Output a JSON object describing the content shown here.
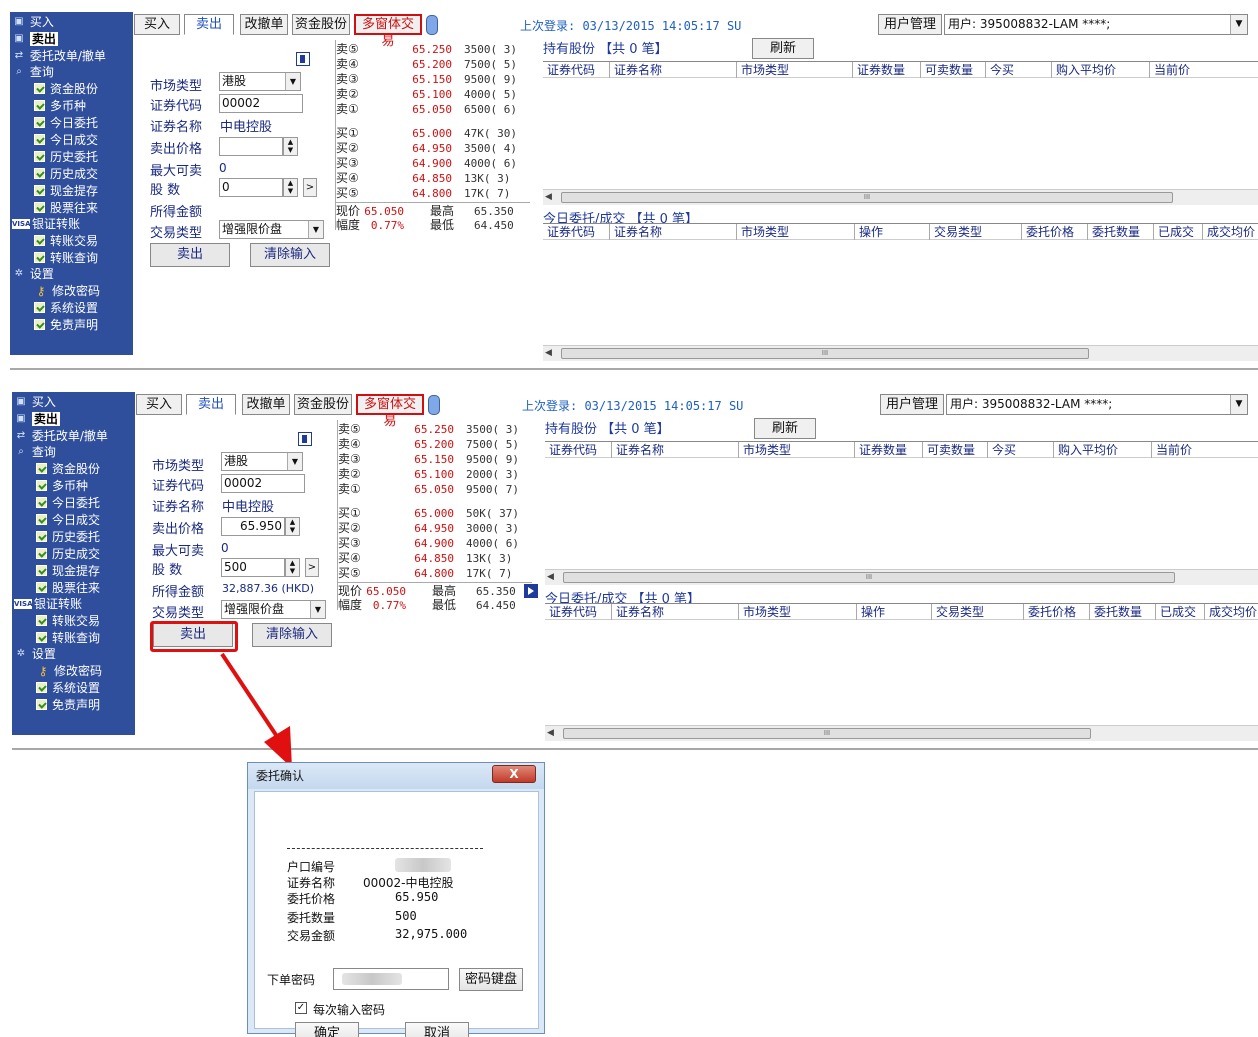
{
  "sidebar": {
    "buy": "买入",
    "sell": "卖出",
    "modify_cancel": "委托改单/撤单",
    "query": "查询",
    "query_items": [
      "资金股份",
      "多币种",
      "今日委托",
      "今日成交",
      "历史委托",
      "历史成交",
      "现金提存",
      "股票往来"
    ],
    "transfer": "银证转账",
    "transfer_items": [
      "转账交易",
      "转账查询"
    ],
    "settings": "设置",
    "settings_items": [
      "修改密码",
      "系统设置",
      "免责声明"
    ]
  },
  "tabs": [
    "买入",
    "卖出",
    "改撤单",
    "资金股份",
    "多窗体交易"
  ],
  "last_login": "上次登录: 03/13/2015 14:05:17 SU",
  "user_manage": "用户管理",
  "user_combo": "用户: 395008832-LAM ****;",
  "form": {
    "market_type_label": "市场类型",
    "market_type": "港股",
    "code_label": "证券代码",
    "code": "00002",
    "name_label": "证券名称",
    "name": "中电控股",
    "price_label": "卖出价格",
    "max_sell_label": "最大可卖",
    "max_sell": "0",
    "qty_label": "股    数",
    "amount_label": "所得金额",
    "trade_type_label": "交易类型",
    "trade_type": "增强限价盘",
    "sell_btn": "卖出",
    "clear_btn": "清除输入"
  },
  "top_form": {
    "price": "",
    "qty": "0",
    "amount": ""
  },
  "bottom_form": {
    "price": "65.950",
    "qty": "500",
    "amount": "32,887.36 (HKD)"
  },
  "quote_top": {
    "asks": [
      {
        "label": "卖⑤",
        "price": "65.250",
        "vol": "3500( 3)"
      },
      {
        "label": "卖④",
        "price": "65.200",
        "vol": "7500( 5)"
      },
      {
        "label": "卖③",
        "price": "65.150",
        "vol": "9500( 9)"
      },
      {
        "label": "卖②",
        "price": "65.100",
        "vol": "4000( 5)"
      },
      {
        "label": "卖①",
        "price": "65.050",
        "vol": "6500( 6)"
      }
    ],
    "bids": [
      {
        "label": "买①",
        "price": "65.000",
        "vol": "47K( 30)"
      },
      {
        "label": "买②",
        "price": "64.950",
        "vol": "3500( 4)"
      },
      {
        "label": "买③",
        "price": "64.900",
        "vol": "4000( 6)"
      },
      {
        "label": "买④",
        "price": "64.850",
        "vol": "13K( 3)"
      },
      {
        "label": "买⑤",
        "price": "64.800",
        "vol": "17K( 7)"
      }
    ]
  },
  "quote_bottom": {
    "asks": [
      {
        "label": "卖⑤",
        "price": "65.250",
        "vol": "3500( 3)"
      },
      {
        "label": "卖④",
        "price": "65.200",
        "vol": "7500( 5)"
      },
      {
        "label": "卖③",
        "price": "65.150",
        "vol": "9500( 9)"
      },
      {
        "label": "卖②",
        "price": "65.100",
        "vol": "2000( 3)"
      },
      {
        "label": "卖①",
        "price": "65.050",
        "vol": "9500( 7)"
      }
    ],
    "bids": [
      {
        "label": "买①",
        "price": "65.000",
        "vol": "50K( 37)"
      },
      {
        "label": "买②",
        "price": "64.950",
        "vol": "3000( 3)"
      },
      {
        "label": "买③",
        "price": "64.900",
        "vol": "4000( 6)"
      },
      {
        "label": "买④",
        "price": "64.850",
        "vol": "13K( 3)"
      },
      {
        "label": "买⑤",
        "price": "64.800",
        "vol": "17K( 7)"
      }
    ]
  },
  "quote_summary": {
    "now_label": "现价",
    "now": "65.050",
    "high_label": "最高",
    "high": "65.350",
    "range_label": "幅度",
    "range": "0.77%",
    "low_label": "最低",
    "low": "64.450"
  },
  "holdings": {
    "title": "持有股份  【共  0 笔】",
    "refresh": "刷新",
    "columns": [
      "证券代码",
      "证券名称",
      "市场类型",
      "证券数量",
      "可卖数量",
      "今买",
      "购入平均价",
      "当前价"
    ]
  },
  "orders": {
    "title": "今日委托/成交 【共  0 笔】",
    "columns": [
      "证券代码",
      "证券名称",
      "市场类型",
      "操作",
      "交易类型",
      "委托价格",
      "委托数量",
      "已成交",
      "成交均价"
    ]
  },
  "dialog": {
    "title": "委托确认",
    "close": "X",
    "separator": "--------------------------------",
    "account_label": "户口编号",
    "name_label": "证券名称",
    "name": "00002-中电控股",
    "price_label": "委托价格",
    "price": "65.950",
    "qty_label": "委托数量",
    "qty": "500",
    "amount_label": "交易金额",
    "amount": "32,975.000",
    "pwd_label": "下单密码",
    "keyboard_btn": "密码键盘",
    "every_time": "每次输入密码",
    "ok": "确定",
    "cancel": "取消"
  },
  "colors": {
    "sidebar": "#2f4f9c",
    "accent": "#2050c0",
    "price_red": "#d01010",
    "highlight": "#e01010"
  }
}
